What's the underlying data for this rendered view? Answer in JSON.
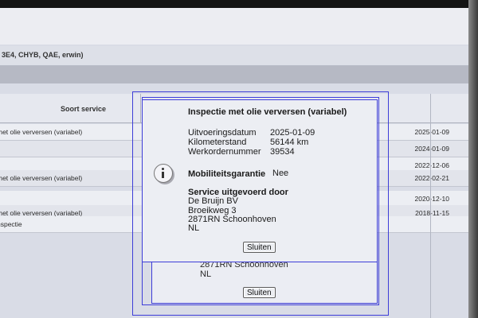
{
  "vehicle_bar": {
    "text": "3E4, CHYB, QAE, erwin)"
  },
  "table": {
    "header": {
      "service": "Soort service"
    },
    "rows": [
      {
        "service": "met olie verversen (variabel)",
        "date": "2025-01-09"
      },
      {
        "service": "",
        "date": "2024-01-09"
      },
      {
        "service": "",
        "date": "2022-12-06"
      },
      {
        "service": "met olie verversen (variabel)",
        "date": "2022-02-21"
      },
      {
        "service": "",
        "date": "2020-12-10"
      },
      {
        "service": "met olie verversen (variabel)",
        "date": "2018-11-15"
      },
      {
        "service": "nspectie",
        "date": ""
      }
    ]
  },
  "dialog": {
    "title": "Inspectie met olie verversen (variabel)",
    "fields": {
      "date_label": "Uitvoeringsdatum",
      "date_value": "2025-01-09",
      "km_label": "Kilometerstand",
      "km_value": "56144 km",
      "order_label": "Werkordernummer",
      "order_value": "39534",
      "mob_label": "Mobiliteitsgarantie",
      "mob_value": "Nee"
    },
    "service_by": {
      "heading": "Service uitgevoerd door",
      "name": "De Bruijn BV",
      "street": "Broeikweg 3",
      "city": "2871RN Schoonhoven",
      "country": "NL"
    },
    "close_label": "Sluiten"
  },
  "back_dialog": {
    "city": "2871RN Schoonhoven",
    "country": "NL",
    "close_label": "Sluiten"
  },
  "colors": {
    "dialog_border": "#3d3dd8",
    "screen_bg": "#d9dce6"
  },
  "icons": {
    "info": "info-icon"
  }
}
